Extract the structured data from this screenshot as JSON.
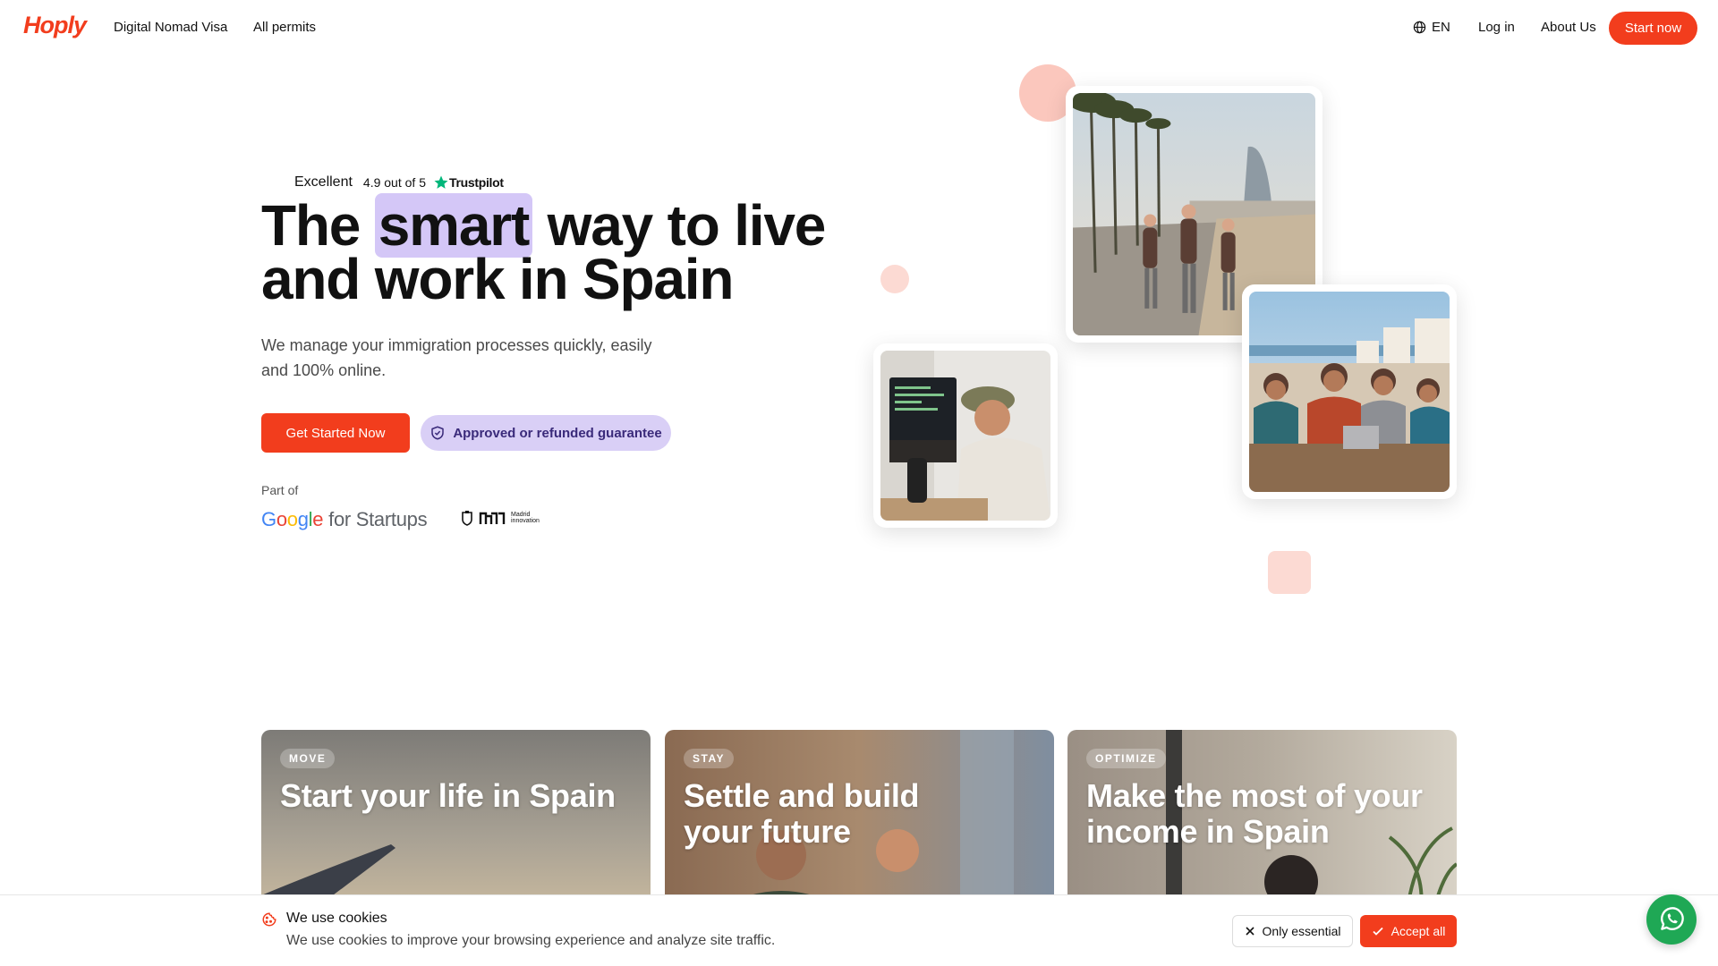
{
  "brand": {
    "name": "Hoply",
    "color": "#f23d1d"
  },
  "nav": {
    "links": [
      "Digital Nomad Visa",
      "All permits"
    ],
    "language": "EN",
    "login": "Log in",
    "about": "About Us",
    "cta": "Start now"
  },
  "rating": {
    "label": "Excellent",
    "score": "4.9 out of 5",
    "provider": "Trustpilot"
  },
  "hero": {
    "title_part1": "The ",
    "title_highlight": "smart",
    "title_part2": " way to live and work in Spain",
    "subtitle": "We manage your immigration processes quickly, easily and 100% online.",
    "cta": "Get Started Now",
    "guarantee": "Approved or refunded guarantee",
    "highlight_color": "#d4c7f7"
  },
  "partners": {
    "label": "Part of",
    "google_word": "Google",
    "google_suffix": "for Startups",
    "madrid_line1": "Madrid",
    "madrid_line2": "innovation"
  },
  "cards": [
    {
      "tag": "MOVE",
      "title": "Start your life in Spain"
    },
    {
      "tag": "STAY",
      "title": "Settle and build your future"
    },
    {
      "tag": "OPTIMIZE",
      "title": "Make the most of your income in Spain"
    }
  ],
  "cookies": {
    "title": "We use cookies",
    "text": "We use cookies to improve your browsing experience and analyze site traffic.",
    "essential": "Only essential",
    "accept": "Accept all"
  },
  "icons": [
    "globe-icon",
    "trustpilot-star-icon",
    "shield-icon",
    "cookie-icon",
    "close-icon",
    "check-icon",
    "whatsapp-icon"
  ]
}
